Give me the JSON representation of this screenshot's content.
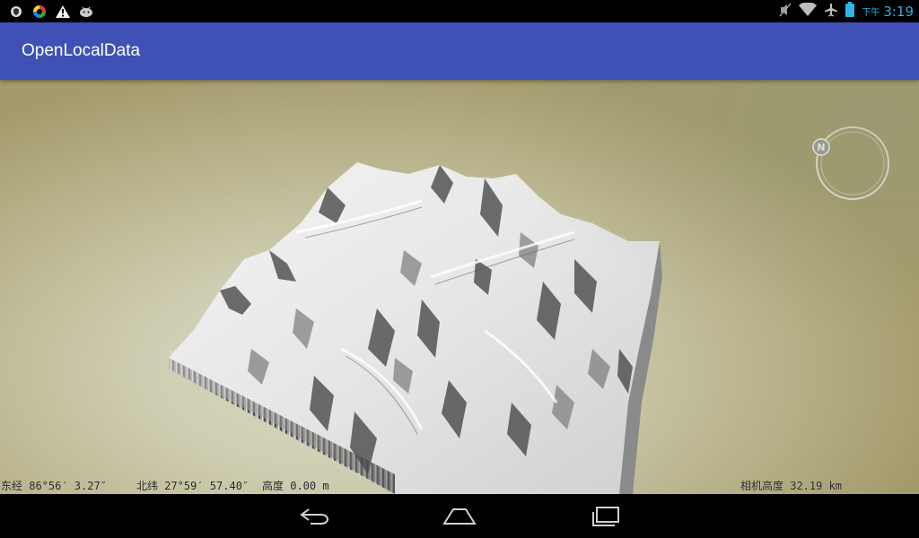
{
  "status_bar": {
    "left_icons": [
      "shield-icon",
      "app-color-icon",
      "warning-icon",
      "android-icon"
    ],
    "right_icons": [
      "mute-icon",
      "wifi-icon",
      "airplane-icon",
      "battery-icon"
    ],
    "ampm": "下午",
    "time": "3:19",
    "time_color": "#2db4e8"
  },
  "app_bar": {
    "title": "OpenLocalData",
    "color": "#3f51b5"
  },
  "scene": {
    "compass_label": "N",
    "coords": {
      "longitude": "东经 86°56′ 3.27″",
      "latitude": "北纬 27°59′ 57.40″",
      "altitude": "高度 0.00 m",
      "camera_altitude": "相机高度 32.19 km"
    }
  },
  "nav_bar": {
    "buttons": [
      "back-icon",
      "home-icon",
      "recents-icon"
    ]
  }
}
